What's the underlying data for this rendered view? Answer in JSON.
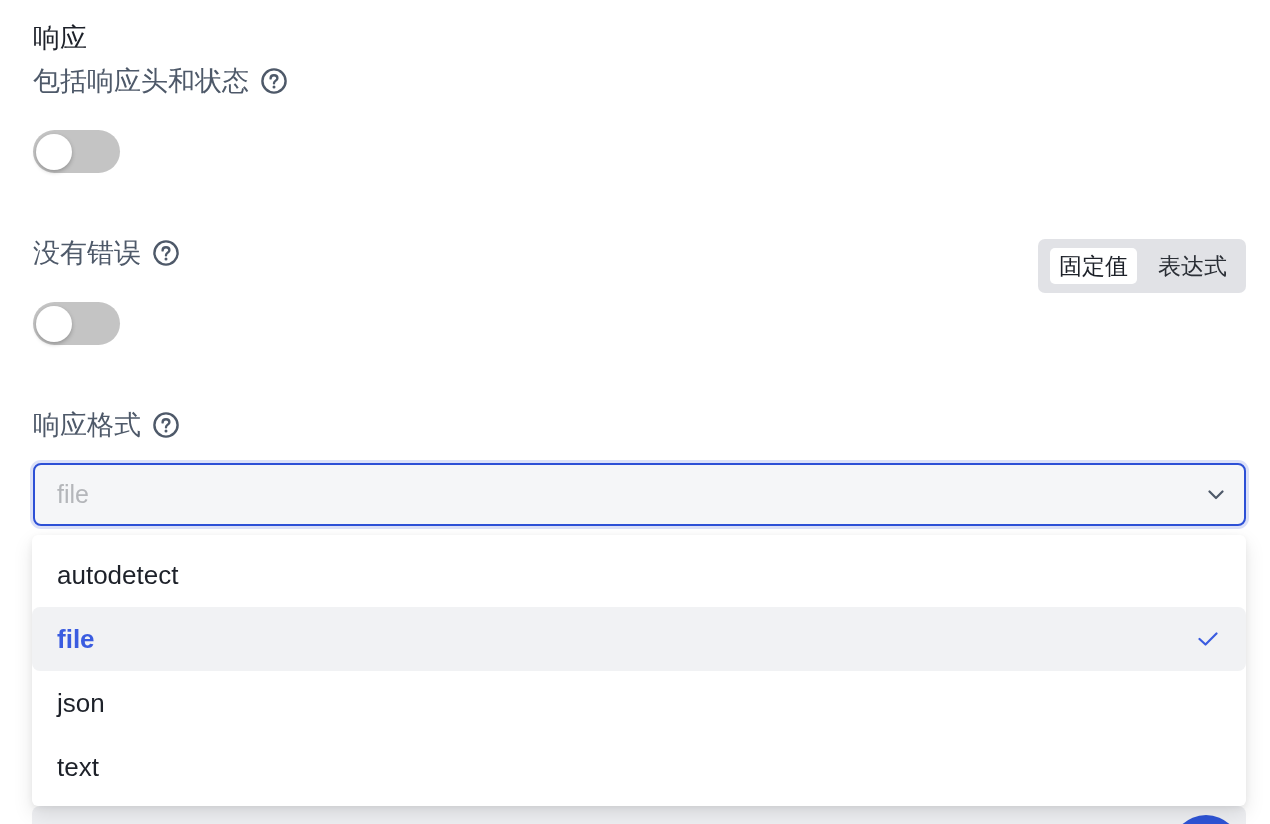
{
  "section_title": "响应",
  "fields": [
    {
      "kind": "toggle",
      "label": "包括响应头和状态",
      "on": false
    },
    {
      "kind": "toggle",
      "label": "没有错误",
      "on": false,
      "modes": [
        {
          "label": "固定值",
          "selected": true
        },
        {
          "label": "表达式",
          "selected": false
        }
      ]
    },
    {
      "kind": "select",
      "label": "响应格式",
      "value": "file",
      "focused": true,
      "expanded": true,
      "options": [
        {
          "label": "autodetect",
          "selected": false
        },
        {
          "label": "file",
          "selected": true
        },
        {
          "label": "json",
          "selected": false
        },
        {
          "label": "text",
          "selected": false
        }
      ]
    }
  ]
}
